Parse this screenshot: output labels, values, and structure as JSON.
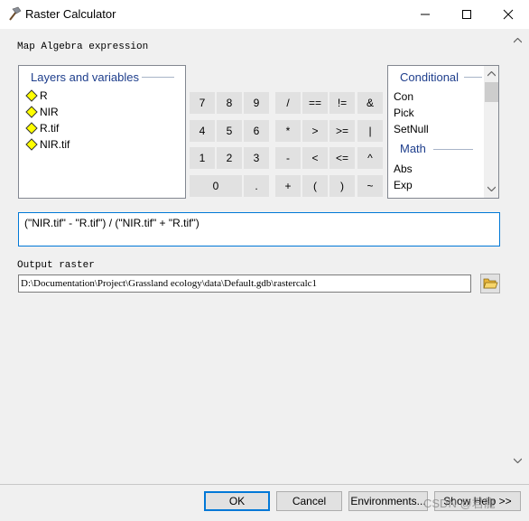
{
  "window": {
    "title": "Raster Calculator",
    "icon": "hammer-icon",
    "minimize_icon": "minimize-icon",
    "maximize_icon": "maximize-icon",
    "close_icon": "close-icon"
  },
  "map_algebra_label": "Map Algebra expression",
  "layers": {
    "header": "Layers and variables",
    "items": [
      "R",
      "NIR",
      "R.tif",
      "NIR.tif"
    ],
    "item_icon": "diamond-icon",
    "icon_color": "#ffff00"
  },
  "calculator": {
    "rows": [
      [
        "7",
        "8",
        "9",
        "/",
        "==",
        "!=",
        "&"
      ],
      [
        "4",
        "5",
        "6",
        "*",
        ">",
        ">=",
        "|"
      ],
      [
        "1",
        "2",
        "3",
        "-",
        "<",
        "<=",
        "^"
      ],
      [
        "0",
        ".",
        "+",
        "(",
        ")",
        "~"
      ]
    ]
  },
  "functions": {
    "groups": [
      {
        "header": "Conditional",
        "items": [
          "Con",
          "Pick",
          "SetNull"
        ]
      },
      {
        "header": "Math",
        "items": [
          "Abs",
          "Exp"
        ]
      }
    ],
    "accent": "#1e3e8c"
  },
  "expression": "(\"NIR.tif\" - \"R.tif\") / (\"NIR.tif\" + \"R.tif\")",
  "output": {
    "label": "Output raster",
    "value": "D:\\Documentation\\Project\\Grassland ecology\\data\\Default.gdb\\rastercalc1",
    "browse_icon": "folder-open-icon"
  },
  "buttons": {
    "ok": "OK",
    "cancel": "Cancel",
    "environments": "Environments...",
    "help": "Show Help >>"
  },
  "watermark": "CSDN @君龍",
  "colors": {
    "ok_border": "#0078d7",
    "expression_border": "#0078d7"
  }
}
